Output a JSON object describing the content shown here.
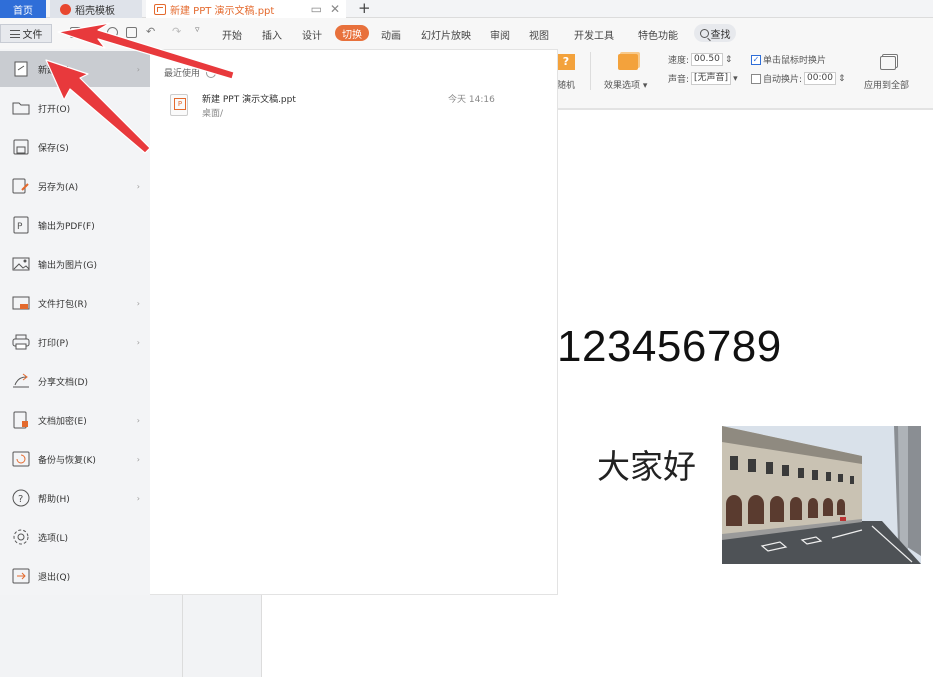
{
  "tabs": {
    "home": "首页",
    "templates": "稻壳模板",
    "document": "新建 PPT 演示文稿.ppt",
    "plus": "+"
  },
  "menu": {
    "file": "文件",
    "items": [
      "开始",
      "插入",
      "设计",
      "切换",
      "动画",
      "幻灯片放映",
      "审阅",
      "视图",
      "开发工具",
      "特色功能"
    ],
    "active": "切换",
    "search": "查找"
  },
  "ribbon": {
    "transition_label": "随机",
    "effect_options": "效果选项",
    "speed_label": "速度:",
    "speed_value": "00.50",
    "sound_label": "声音:",
    "sound_value": "[无声音]",
    "on_click": "单击鼠标时换片",
    "auto_switch": "自动换片:",
    "auto_value": "00:00",
    "apply_all": "应用到全部"
  },
  "file_menu": {
    "items": [
      {
        "label": "新建(N)",
        "icon": "new-icon",
        "arrow": true
      },
      {
        "label": "打开(O)",
        "icon": "folder-icon",
        "arrow": false
      },
      {
        "label": "保存(S)",
        "icon": "save-icon",
        "arrow": false
      },
      {
        "label": "另存为(A)",
        "icon": "save-as-icon",
        "arrow": true
      },
      {
        "label": "输出为PDF(F)",
        "icon": "pdf-icon",
        "arrow": false
      },
      {
        "label": "输出为图片(G)",
        "icon": "image-icon",
        "arrow": false
      },
      {
        "label": "文件打包(R)",
        "icon": "package-icon",
        "arrow": true
      },
      {
        "label": "打印(P)",
        "icon": "printer-icon",
        "arrow": true
      },
      {
        "label": "分享文档(D)",
        "icon": "share-icon",
        "arrow": false
      },
      {
        "label": "文档加密(E)",
        "icon": "encrypt-icon",
        "arrow": true
      },
      {
        "label": "备份与恢复(K)",
        "icon": "backup-icon",
        "arrow": true
      },
      {
        "label": "帮助(H)",
        "icon": "help-icon",
        "arrow": true
      },
      {
        "label": "选项(L)",
        "icon": "settings-icon",
        "arrow": false
      },
      {
        "label": "退出(Q)",
        "icon": "exit-icon",
        "arrow": false
      }
    ],
    "active_index": 0
  },
  "recent": {
    "title": "最近使用",
    "file_name": "新建 PPT 演示文稿.ppt",
    "file_path": "桌面/",
    "file_time": "今天 14:16"
  },
  "slide": {
    "numbers": "123456789",
    "greeting": "大家好"
  },
  "colors": {
    "accent": "#2f6ed8",
    "active_tab": "#e8713c",
    "annotation_arrow": "#e8393c"
  }
}
